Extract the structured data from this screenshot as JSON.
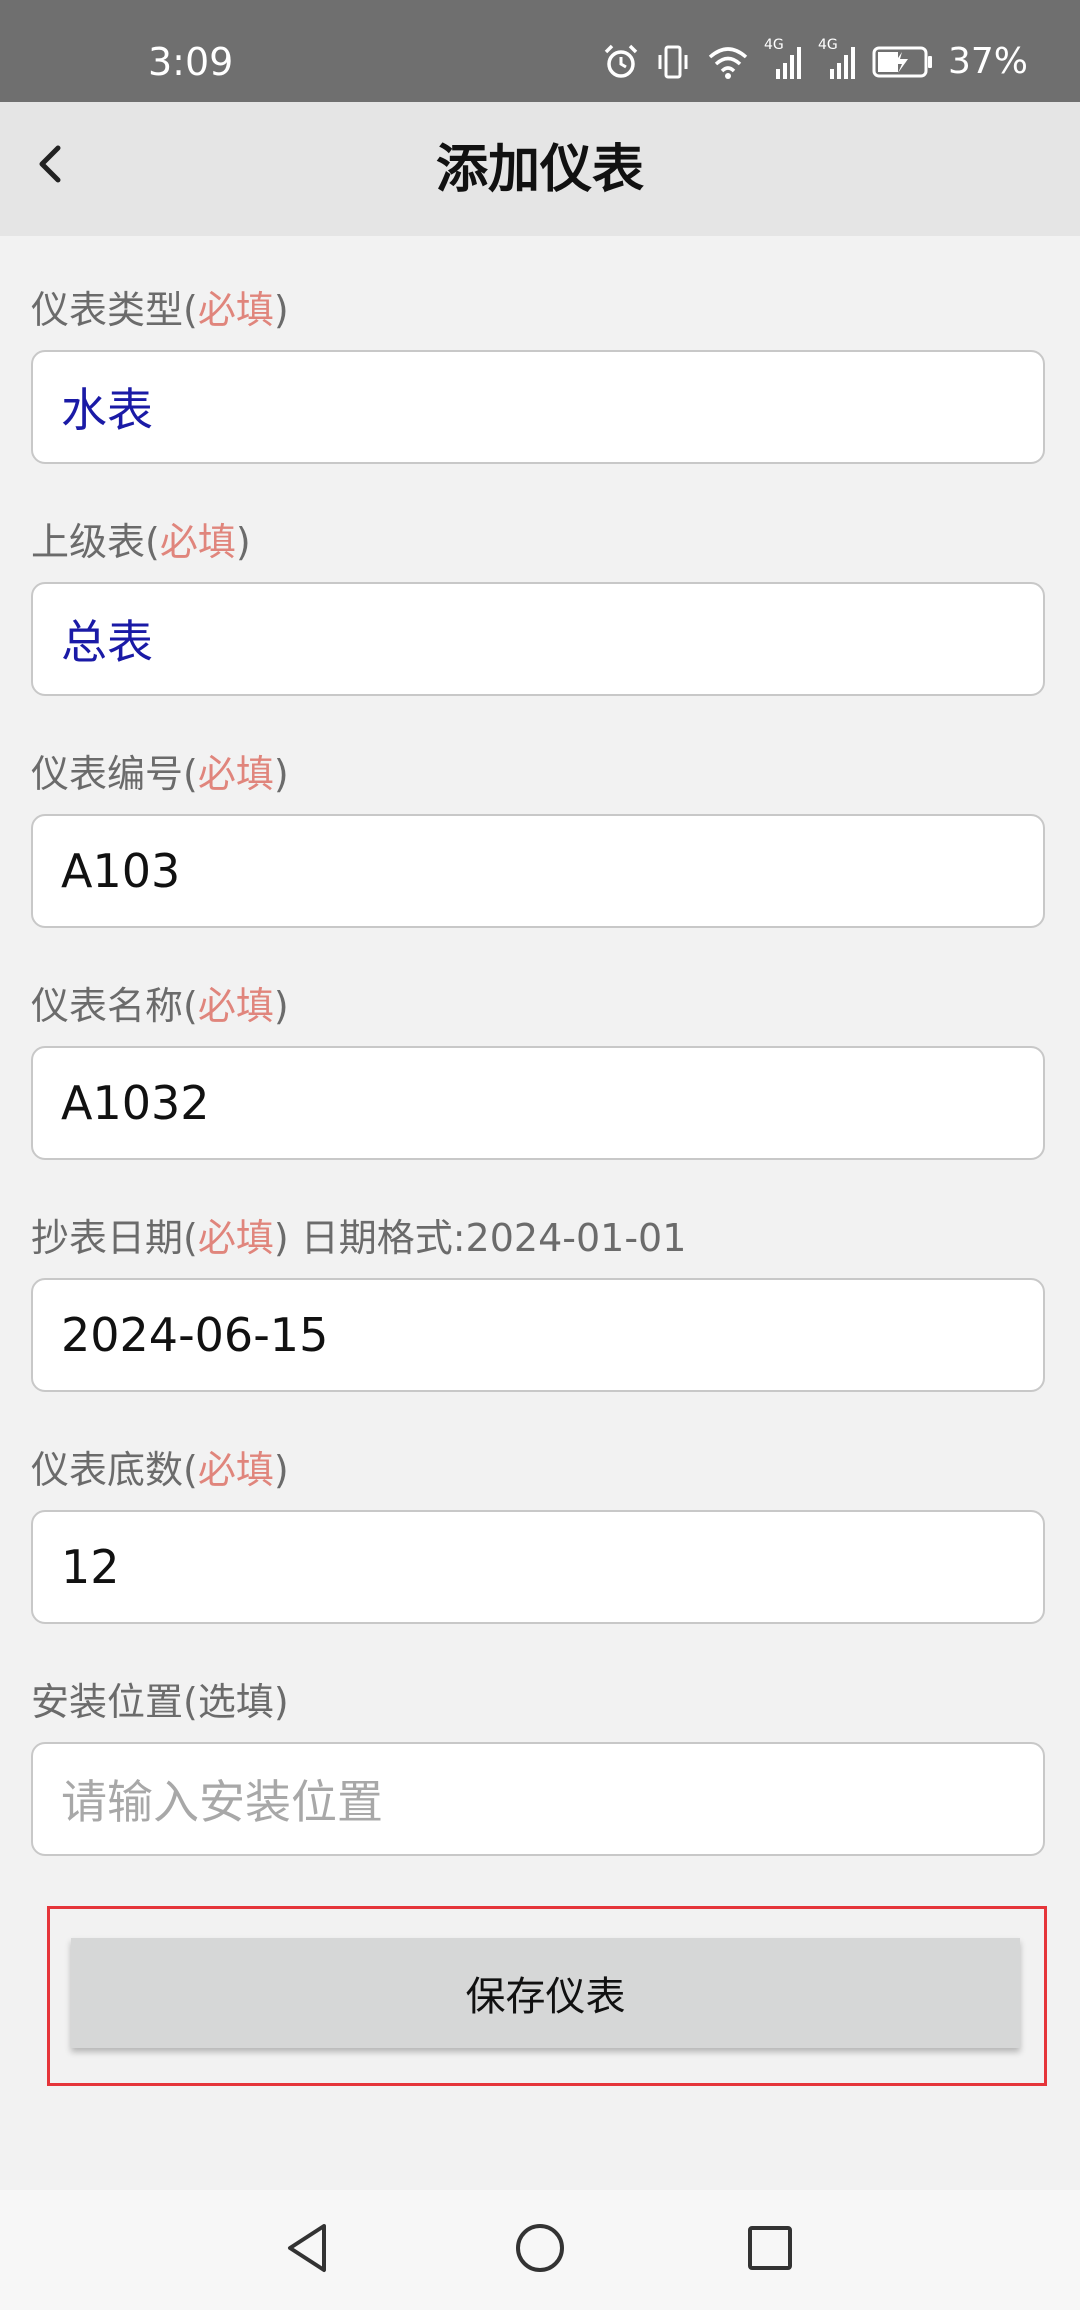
{
  "status_bar": {
    "time": "3:09",
    "battery": "37%",
    "icons": [
      "alarm-icon",
      "vibrate-icon",
      "wifi-icon",
      "signal-4g-icon",
      "signal-4g-icon",
      "battery-charging-icon"
    ],
    "signal_labels": [
      "4G",
      "4G"
    ]
  },
  "header": {
    "title": "添加仪表",
    "back_icon": "chevron-left-icon"
  },
  "form": {
    "fields": [
      {
        "label_main": "仪表类型(",
        "label_req": "必填",
        "label_end": ")",
        "label_extra": "",
        "value": "水表"
      },
      {
        "label_main": "上级表(",
        "label_req": "必填",
        "label_end": ")",
        "label_extra": "",
        "value": "总表"
      },
      {
        "label_main": "仪表编号(",
        "label_req": "必填",
        "label_end": ")",
        "label_extra": "",
        "value": "A103"
      },
      {
        "label_main": "仪表名称(",
        "label_req": "必填",
        "label_end": ")",
        "label_extra": "",
        "value": "A1032"
      },
      {
        "label_main": "抄表日期(",
        "label_req": "必填",
        "label_end": ")",
        "label_extra": " 日期格式:2024-01-01",
        "value": "2024-06-15"
      },
      {
        "label_main": "仪表底数(",
        "label_req": "必填",
        "label_end": ")",
        "label_extra": "",
        "value": "12"
      },
      {
        "label_main": "安装位置(选填)",
        "label_req": "",
        "label_end": "",
        "label_extra": "",
        "value": "",
        "placeholder": "请输入安装位置"
      }
    ]
  },
  "save_button": {
    "label": "保存仪表"
  },
  "nav_bar": {
    "icons": [
      "back-triangle-icon",
      "home-circle-icon",
      "recents-square-icon"
    ]
  },
  "colors": {
    "status_bar_bg": "#6f6f6f",
    "app_bar_bg": "#e5e5e5",
    "page_bg": "#f2f2f2",
    "required_text": "#e0857c",
    "picker_value_text": "#1a1aa6",
    "highlight_border": "#e5353a",
    "button_bg": "#d6d7d7"
  }
}
